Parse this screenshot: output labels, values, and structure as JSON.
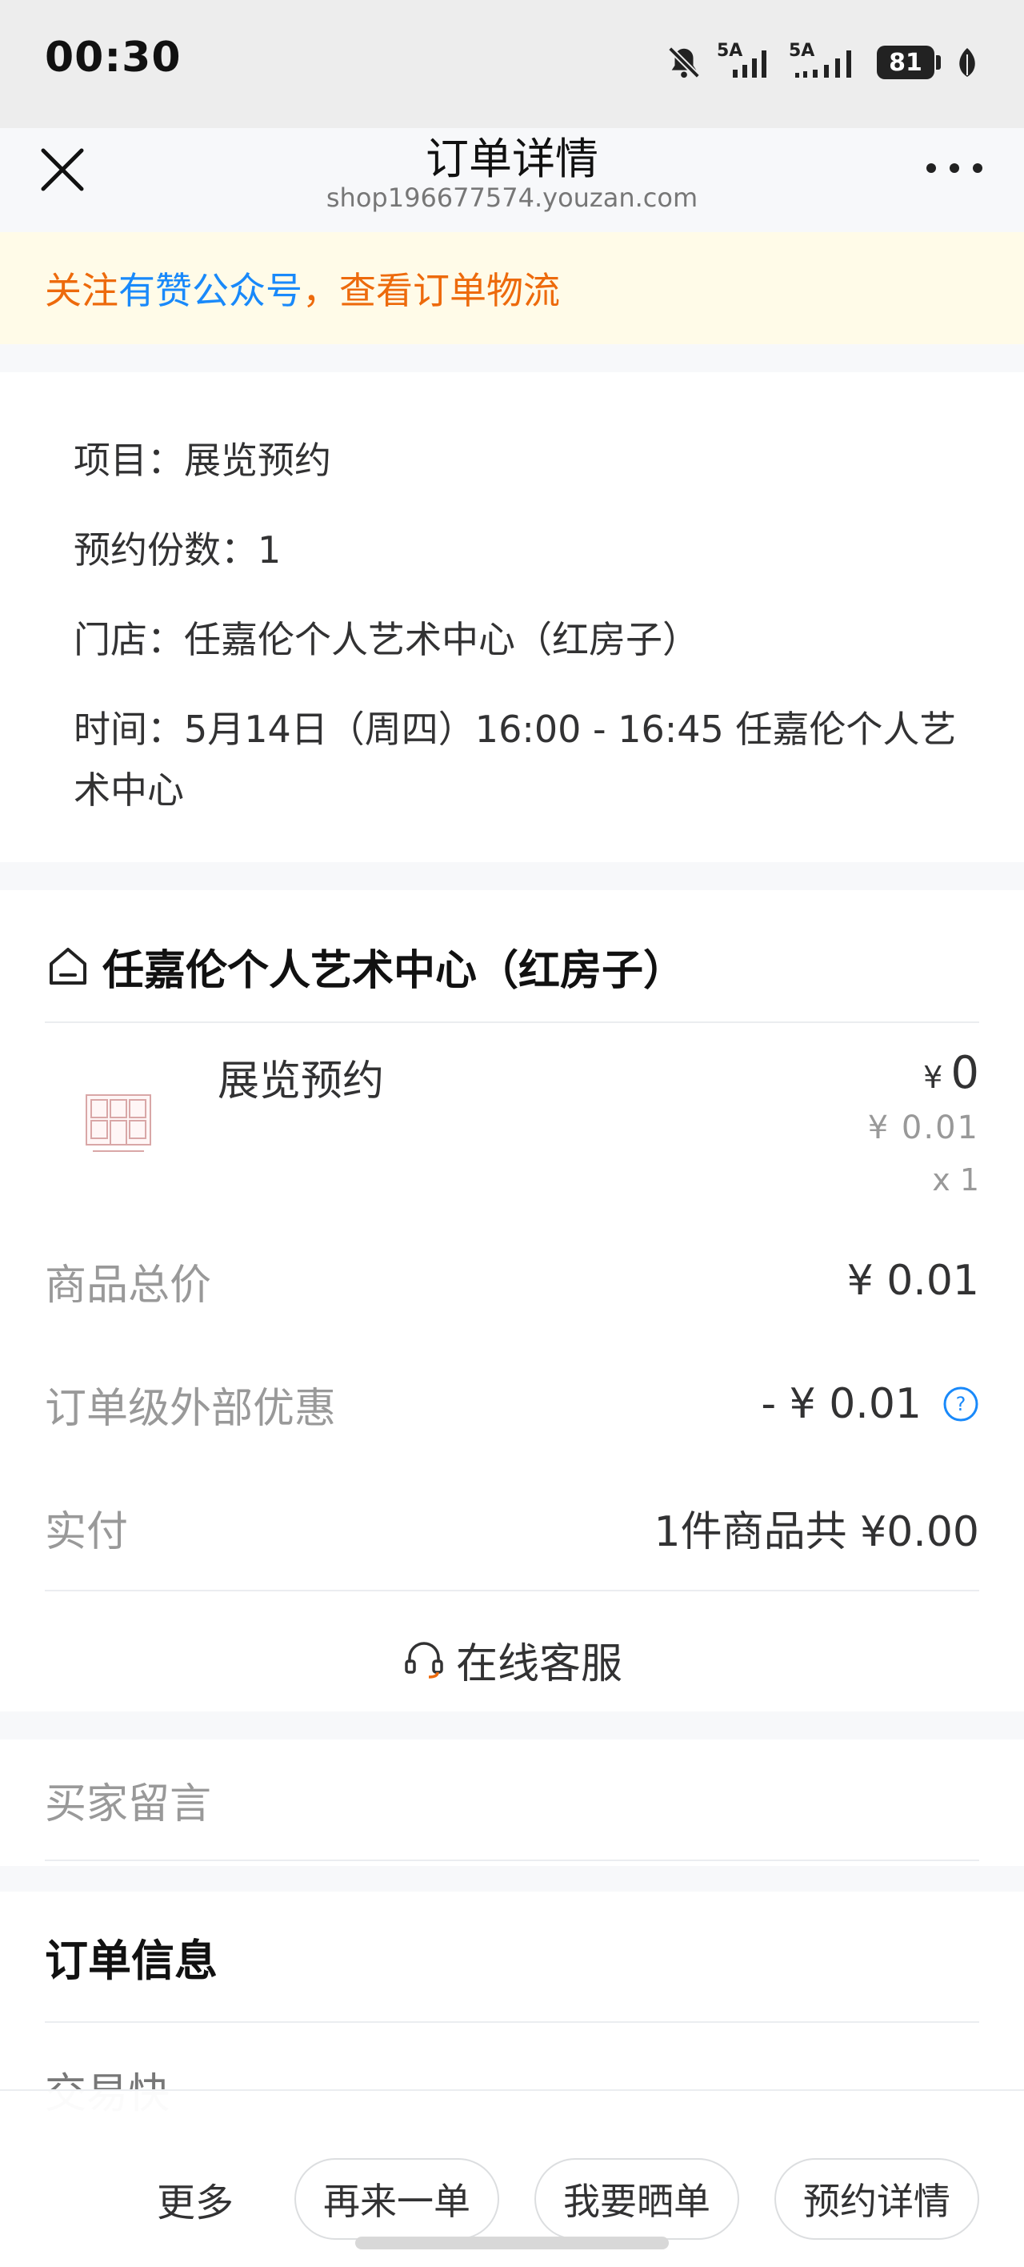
{
  "status_bar": {
    "time": "00:30",
    "network_1": "5A",
    "network_2": "5A",
    "battery": "81",
    "icons": [
      "mute-bell-icon",
      "signal-icon",
      "signal-icon",
      "battery-icon",
      "leaf-icon"
    ]
  },
  "nav": {
    "title": "订单详情",
    "subtitle": "shop196677574.youzan.com"
  },
  "notice": {
    "prefix": "关注 ",
    "link": "有赞公众号",
    "suffix": "，查看订单物流"
  },
  "appointment": {
    "project": "项目：展览预约",
    "count": "预约份数：1",
    "store": "门店：任嘉伦个人艺术中心（红房子）",
    "time": "时间：5月14日（周四）16:00 - 16:45 任嘉伦个人艺术中心"
  },
  "shop": {
    "name": "任嘉伦个人艺术中心（红房子）"
  },
  "goods": {
    "name": "展览预约",
    "currency": "¥",
    "price": "0",
    "original_price": "¥ 0.01",
    "quantity": "x 1"
  },
  "summary": {
    "total_label": "商品总价",
    "total_value": "¥ 0.01",
    "discount_label": "订单级外部优惠",
    "discount_value": "- ¥ 0.01",
    "paid_label": "实付",
    "paid_value": "1件商品共 ¥0.00"
  },
  "service": {
    "label": "在线客服"
  },
  "memo": {
    "label": "买家留言"
  },
  "order_info": {
    "title": "订单信息",
    "partial_row": "交易快"
  },
  "actions": {
    "more": "更多",
    "reorder": "再来一单",
    "share": "我要晒单",
    "booking_detail": "预约详情"
  },
  "colors": {
    "notice_text": "#ed6a0c",
    "link": "#1989fa",
    "notice_bg": "#fffbe8"
  }
}
